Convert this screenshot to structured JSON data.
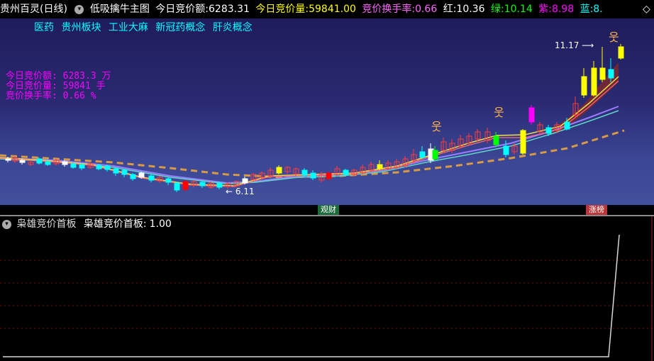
{
  "header": {
    "stock": "贵州百灵(日线)",
    "indicator": "低吸擒牛主图",
    "amount_label": "今日竞价额:",
    "amount_value": "6283.31",
    "volume_label": "今日竞价量:",
    "volume_value": "59841.00",
    "turnover_label": "竞价换手率:",
    "turnover_value": "0.66",
    "red_label": "红:",
    "red_value": "10.36",
    "green_label": "绿:",
    "green_value": "10.14",
    "purple_label": "紫:",
    "purple_value": "8.98",
    "blue_label": "蓝:",
    "blue_value": "8.",
    "colors": {
      "white": "#ffffff",
      "yellow": "#ffff00",
      "pink": "#ff66ff",
      "green": "#00ff00",
      "magenta": "#ff00ff",
      "cyan": "#00ffff"
    }
  },
  "concepts": [
    "医药",
    "贵州板块",
    "工业大麻",
    "新冠药概念",
    "肝炎概念"
  ],
  "stats": {
    "line1": "今日竞价额: 6283.3 万",
    "line2": "今日竞价量: 59841 手",
    "line3": "竞价换手率: 0.66 %"
  },
  "annotations": {
    "high": "11.17",
    "low": "6.11"
  },
  "badges": {
    "left": "观财",
    "right": "涨榜"
  },
  "lower": {
    "title": "枭雄竞价首板",
    "value_label": "枭雄竞价首板:",
    "value": "1.00"
  }
}
